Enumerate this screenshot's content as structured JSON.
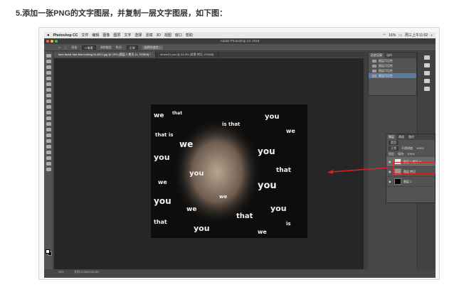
{
  "heading": "5.添加一张PNG的文字图层，并复制一层文字图层，如下图：",
  "menubar": {
    "app": "Photoshop CC",
    "items": [
      "文件",
      "编辑",
      "图像",
      "图层",
      "文字",
      "选择",
      "滤镜",
      "3D",
      "视图",
      "窗口",
      "帮助"
    ],
    "battery": "16%",
    "clock": "周三上午11:02"
  },
  "window_title": "Adobe Photoshop CC 2018",
  "options": {
    "feather_label": "羽化:",
    "feather_value": "0 像素",
    "antialias": "消除锯齿",
    "style_label": "样式:",
    "style_value": "正常",
    "select_mask": "选择并遮住..."
  },
  "doc_tabs": [
    {
      "label": "face-facial-hair-fine-looking-614810.jpg @ 25% (图层 2 拷贝 11, RGB/8) *",
      "active": true
    },
    {
      "label": "renew01.psd @ 33.3% (背景 拷贝, RGB/8)",
      "active": false
    }
  ],
  "history": {
    "tabs": [
      "历史记录",
      "动作"
    ],
    "items": [
      "图层可见性",
      "图层可见性",
      "图层可见性",
      "图层可见性"
    ]
  },
  "layers": {
    "tabs": [
      "图层",
      "通道",
      "路径"
    ],
    "kind": "类型",
    "blend": "正常",
    "opacity_label": "不透明度:",
    "opacity": "100%",
    "lock_label": "锁定:",
    "fill_label": "填充:",
    "fill": "100%",
    "rows": [
      {
        "name": "图层 2 拷贝 11"
      },
      {
        "name": "图层 拷贝"
      },
      {
        "name": "图层 1"
      }
    ]
  },
  "status": {
    "zoom": "25%",
    "doc": "文档:23.6M/103.3M"
  },
  "colors": {
    "highlight": "#e02020",
    "selection": "#5d7aa0"
  }
}
